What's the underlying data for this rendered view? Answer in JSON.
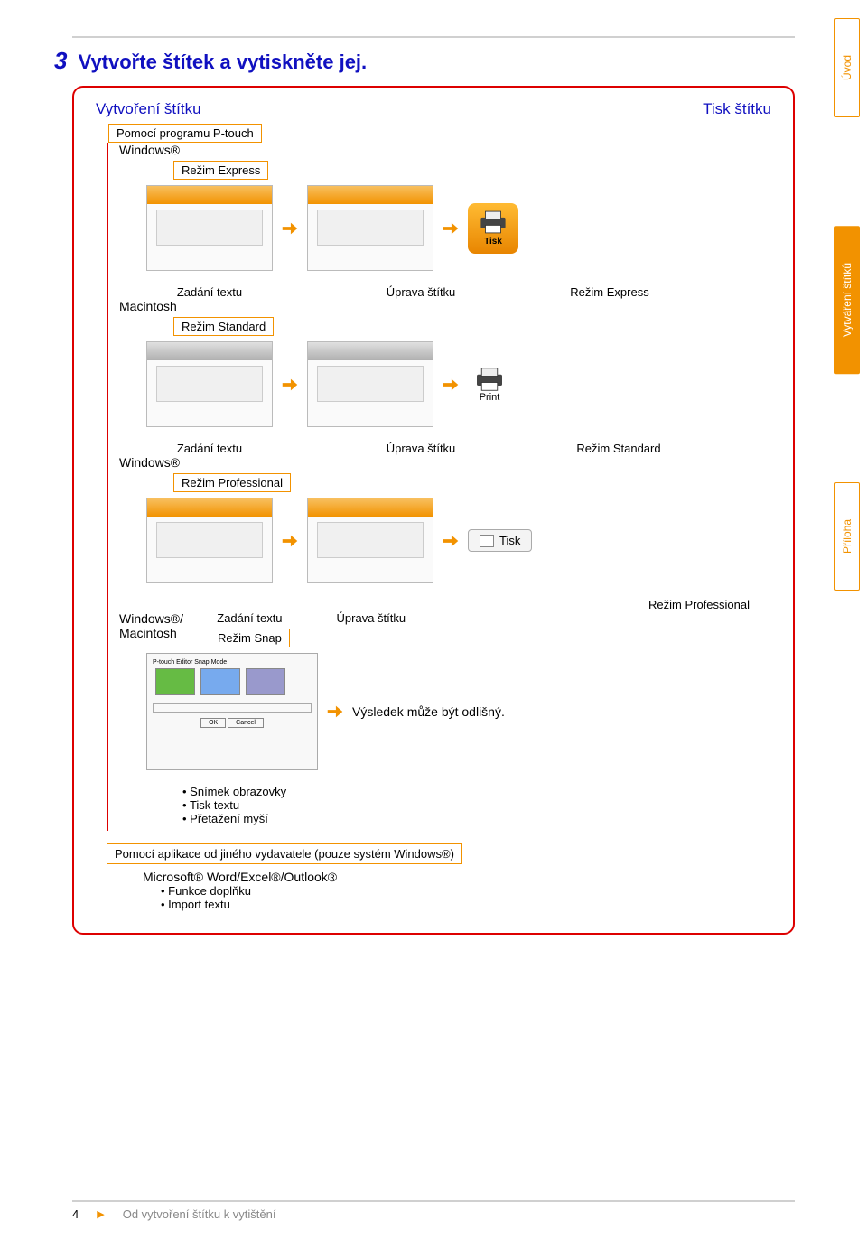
{
  "step": {
    "number": "3",
    "title": "Vytvořte štítek a vytiskněte jej."
  },
  "sections": {
    "create": "Vytvoření štítku",
    "print": "Tisk štítku"
  },
  "ptouch": "Pomocí programu P-touch",
  "os": {
    "windows": "Windows®",
    "macintosh": "Macintosh",
    "winmac": "Windows®/\nMacintosh"
  },
  "modes": {
    "express": "Režim Express",
    "standard": "Režim Standard",
    "professional": "Režim Professional",
    "snap": "Režim Snap"
  },
  "columns": {
    "input": "Zadání textu",
    "edit": "Úprava štítku"
  },
  "icons": {
    "tisk": "Tisk",
    "print": "Print"
  },
  "snap_result": "Výsledek může být odlišný.",
  "snap_bullets": [
    "Snímek obrazovky",
    "Tisk textu",
    "Přetažení myší"
  ],
  "other_app": {
    "title": "Pomocí aplikace od jiného vydavatele (pouze systém Windows®)",
    "sub": "Microsoft® Word/Excel®/Outlook®",
    "bullets": [
      "Funkce doplňku",
      "Import textu"
    ]
  },
  "tabs": {
    "uvod": "Úvod",
    "vytvareni": "Vytváření štítků",
    "priloha": "Příloha"
  },
  "footer": {
    "page": "4",
    "text": "Od vytvoření štítku k vytištění"
  }
}
